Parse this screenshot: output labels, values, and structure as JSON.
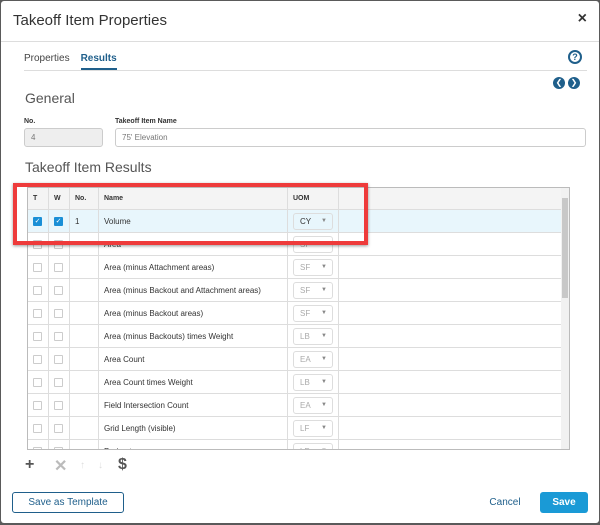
{
  "dialog": {
    "title": "Takeoff Item Properties",
    "close_icon": "×"
  },
  "tabs": [
    {
      "label": "Properties",
      "active": false
    },
    {
      "label": "Results",
      "active": true
    }
  ],
  "help_icon": "?",
  "general": {
    "heading": "General",
    "no_label": "No.",
    "no_value": "4",
    "name_label": "Takeoff Item Name",
    "name_value": "75' Elevation"
  },
  "results": {
    "heading": "Takeoff Item Results",
    "columns": [
      "T",
      "W",
      "No.",
      "Name",
      "UOM"
    ],
    "rows": [
      {
        "t": true,
        "w": true,
        "no": "1",
        "name": "Volume",
        "uom": "CY"
      },
      {
        "t": false,
        "w": false,
        "no": "",
        "name": "Area",
        "uom": "SF"
      },
      {
        "t": false,
        "w": false,
        "no": "",
        "name": "Area (minus Attachment areas)",
        "uom": "SF"
      },
      {
        "t": false,
        "w": false,
        "no": "",
        "name": "Area (minus Backout and Attachment areas)",
        "uom": "SF"
      },
      {
        "t": false,
        "w": false,
        "no": "",
        "name": "Area (minus Backout areas)",
        "uom": "SF"
      },
      {
        "t": false,
        "w": false,
        "no": "",
        "name": "Area (minus Backouts) times Weight",
        "uom": "LB"
      },
      {
        "t": false,
        "w": false,
        "no": "",
        "name": "Area Count",
        "uom": "EA"
      },
      {
        "t": false,
        "w": false,
        "no": "",
        "name": "Area Count times Weight",
        "uom": "LB"
      },
      {
        "t": false,
        "w": false,
        "no": "",
        "name": "Field Intersection Count",
        "uom": "EA"
      },
      {
        "t": false,
        "w": false,
        "no": "",
        "name": "Grid Length (visible)",
        "uom": "LF"
      },
      {
        "t": false,
        "w": false,
        "no": "",
        "name": "Perimeter",
        "uom": "LF"
      }
    ]
  },
  "toolbar": {
    "add": "+",
    "remove": "✕",
    "up": "↑",
    "down": "↓",
    "cost": "$"
  },
  "footer": {
    "save_template": "Save as Template",
    "cancel": "Cancel",
    "save": "Save"
  },
  "colors": {
    "accent": "#1a9ad6",
    "highlight": "#ee3b3b",
    "link": "#1f5f8b"
  }
}
